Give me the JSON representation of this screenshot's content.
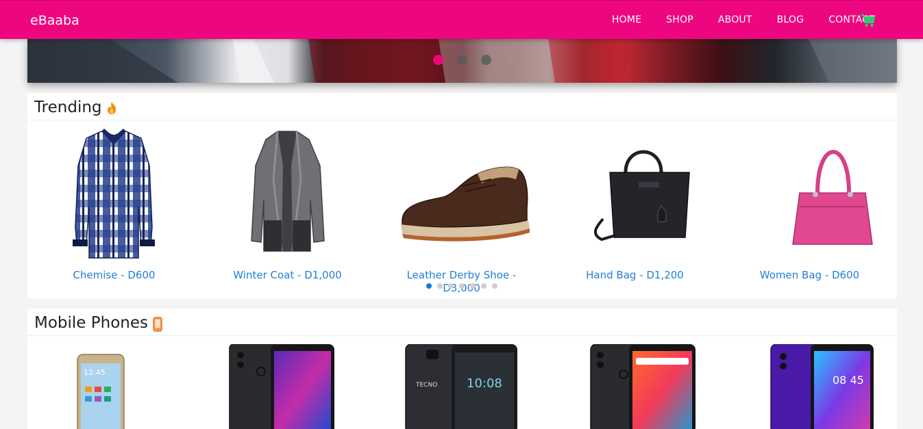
{
  "navbar": {
    "brand": "eBaaba",
    "links": [
      "HOME",
      "SHOP",
      "ABOUT",
      "BLOG",
      "CONTACT"
    ],
    "cart_icon": "shopping-cart-icon",
    "background": "#ee0680",
    "cart_color": "#2ecc71"
  },
  "hero": {
    "slides": 3,
    "active_slide": 1
  },
  "trending": {
    "title": "Trending",
    "icon": "fire-icon",
    "products": [
      {
        "label": "Chemise - D600",
        "image": "plaid-shirt"
      },
      {
        "label": "Winter Coat - D1,000",
        "image": "grey-cardigan"
      },
      {
        "label": "Leather Derby Shoe - D3,000",
        "image": "brown-shoe"
      },
      {
        "label": "Hand Bag - D1,200",
        "image": "black-handbag"
      },
      {
        "label": "Women Bag - D600",
        "image": "pink-bag"
      }
    ],
    "slider_dots": 7,
    "active_dot": 1
  },
  "mobile_phones": {
    "title": "Mobile Phones",
    "icon": "mobile-phone-icon",
    "products": [
      {
        "image": "gold-phone",
        "screen_time": "12:45"
      },
      {
        "image": "black-phone-purple-screen"
      },
      {
        "image": "tecno-phone",
        "brand": "TECNO",
        "screen_time": "10:08"
      },
      {
        "image": "black-phone-orange-screen"
      },
      {
        "image": "purple-phone",
        "screen_time": "08 45"
      }
    ]
  },
  "accent": "#1f7ed6"
}
